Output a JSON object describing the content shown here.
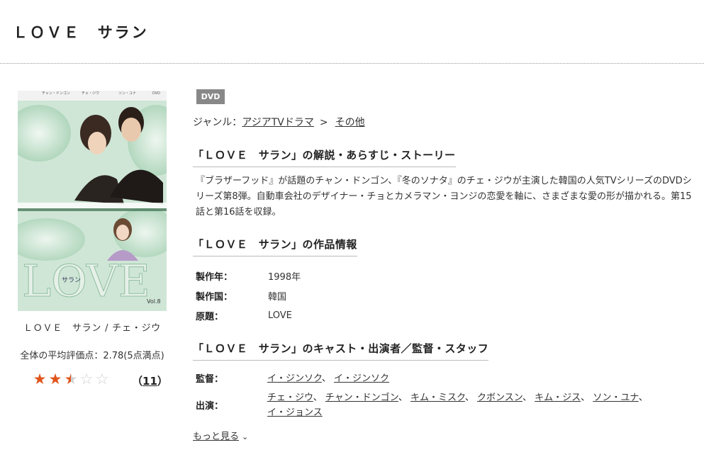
{
  "header": {
    "title": "ＬＯＶＥ　サラン"
  },
  "cover": {
    "logo_text": "LOVE",
    "logo_sub": "サラン",
    "vol_label": "Vol.8",
    "top_badge": "DVD",
    "top_names": [
      "チャン・ドンゴン",
      "チェ・ジウ",
      "ソン・ユナ"
    ],
    "colors": {
      "bg": "#cfe6d6",
      "logo": "#d8e8dc"
    }
  },
  "item": {
    "caption": "ＬＯＶＥ　サラン / チェ・ジウ",
    "rating_text": "全体の平均評価点：2.78(5点満点)",
    "rating_value": 2.78,
    "rating_max": 5,
    "review_count_open": "（",
    "review_count": "11",
    "review_count_close": "）"
  },
  "badge": {
    "label": "DVD"
  },
  "genre": {
    "prefix": "ジャンル：",
    "main": "アジアTVドラマ",
    "separator": ">",
    "sub": "その他"
  },
  "sections": {
    "synopsis_title": "「ＬＯＶＥ　サラン」の解説・あらすじ・ストーリー",
    "synopsis_text": "『ブラザーフッド』が話題のチャン・ドンゴン、『冬のソナタ』のチェ・ジウが主演した韓国の人気TVシリーズのDVDシリーズ第8弾。自動車会社のデザイナー・チョとカメラマン・ヨンジの恋愛を軸に、さまざまな愛の形が描かれる。第15話と第16話を収録。",
    "info_title": "「ＬＯＶＥ　サラン」の作品情報",
    "cast_title": "「ＬＯＶＥ　サラン」のキャスト・出演者／監督・スタッフ"
  },
  "info": [
    {
      "label": "製作年：",
      "value": "1998年"
    },
    {
      "label": "製作国：",
      "value": "韓国"
    },
    {
      "label": "原題：",
      "value": "LOVE"
    }
  ],
  "staff": {
    "director_label": "監督：",
    "directors": [
      "イ・ジンソク",
      "イ・ジンソク"
    ],
    "cast_label": "出演：",
    "cast": [
      "チェ・ジウ",
      "チャン・ドンゴン",
      "キム・ミスク",
      "クボンスン",
      "キム・ジス",
      "ソン・ユナ",
      "イ・ジョンス"
    ],
    "list_separator": "、"
  },
  "more": {
    "label": "もっと見る"
  },
  "colors": {
    "star_on": "#e0541b",
    "star_off": "#d0d0d0",
    "badge_bg": "#888888"
  }
}
